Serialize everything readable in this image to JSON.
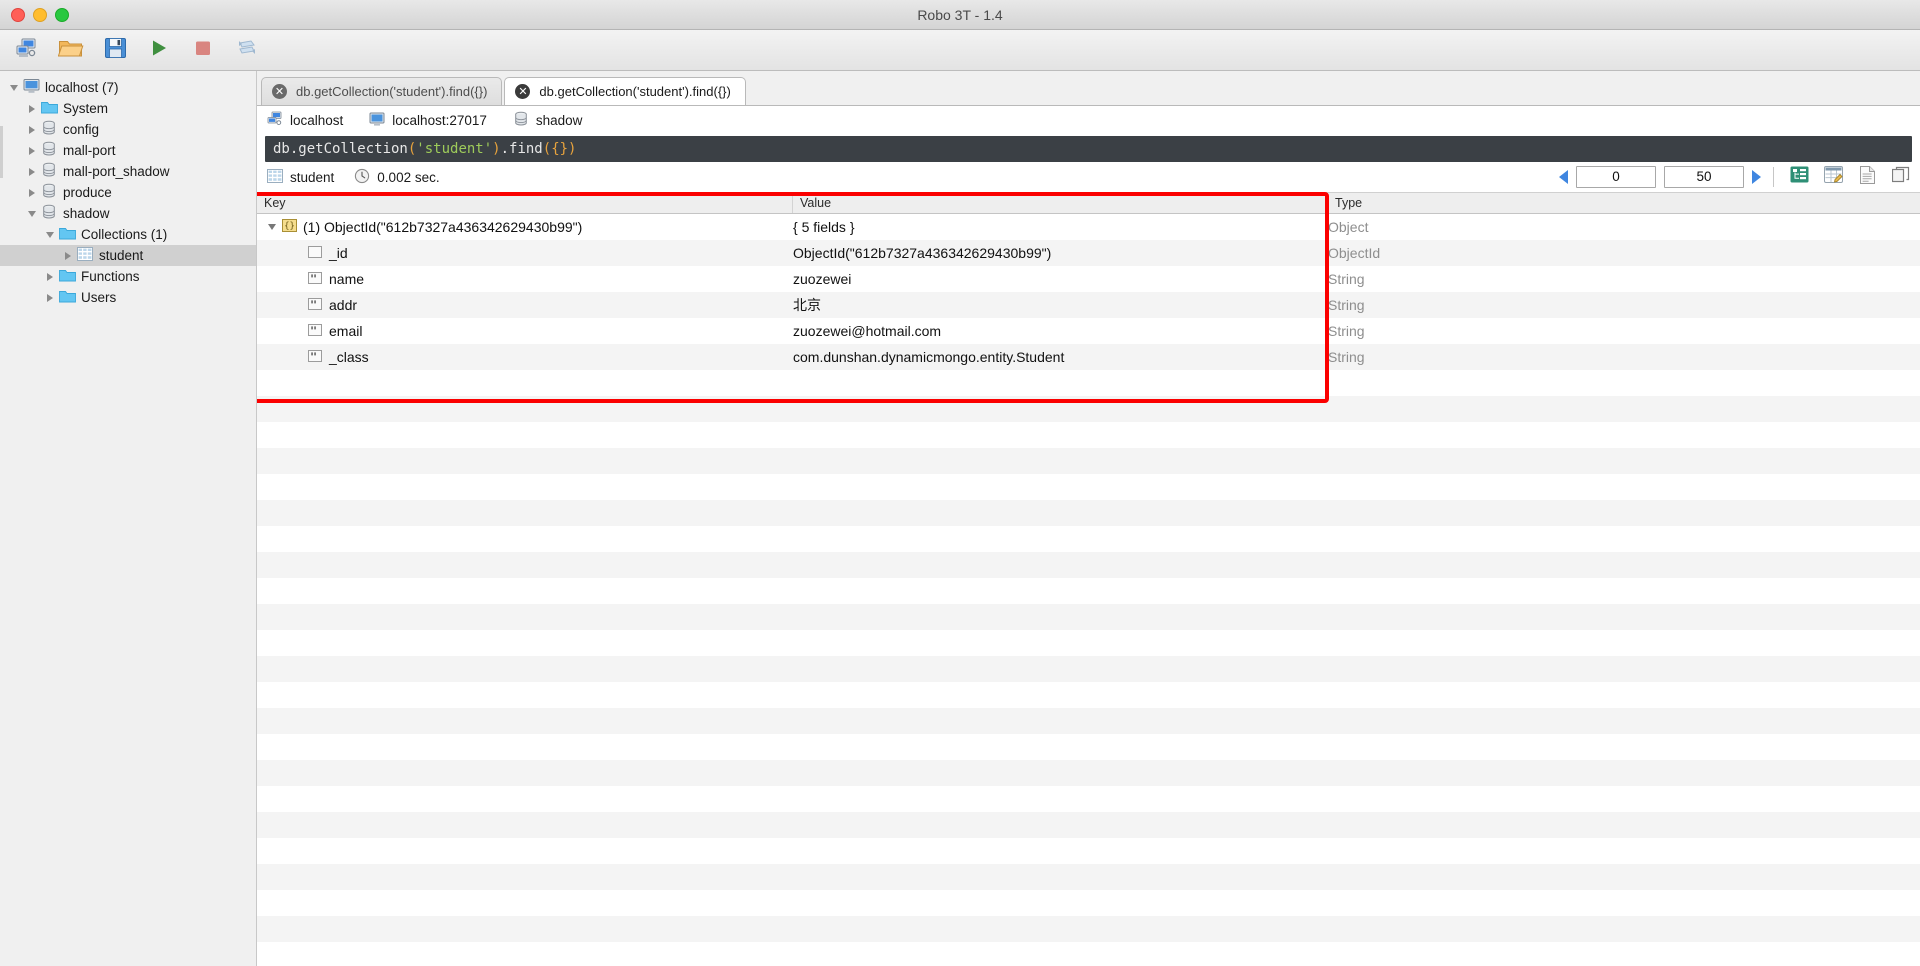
{
  "window": {
    "title": "Robo 3T - 1.4",
    "controls": [
      {
        "name": "close",
        "color": "#ff5f57"
      },
      {
        "name": "minimize",
        "color": "#ffbd2e"
      },
      {
        "name": "maximize",
        "color": "#28c840"
      }
    ]
  },
  "toolbar": {
    "buttons": [
      {
        "icon": "connect-icon",
        "label": "Connect"
      },
      {
        "icon": "open-folder-icon",
        "label": "Open Script"
      },
      {
        "icon": "save-icon",
        "label": "Save"
      },
      {
        "icon": "execute-play-icon",
        "label": "Execute"
      },
      {
        "icon": "stop-icon",
        "label": "Stop"
      },
      {
        "icon": "refresh-icon",
        "label": "Refresh"
      }
    ]
  },
  "sidebar": {
    "items": [
      {
        "label": "localhost (7)",
        "icon": "server-computer-icon",
        "depth": 0,
        "twisty": "open",
        "selected": false
      },
      {
        "label": "System",
        "icon": "folder-icon",
        "depth": 1,
        "twisty": "closed",
        "selected": false
      },
      {
        "label": "config",
        "icon": "database-icon",
        "depth": 1,
        "twisty": "closed",
        "selected": false
      },
      {
        "label": "mall-port",
        "icon": "database-icon",
        "depth": 1,
        "twisty": "closed",
        "selected": false
      },
      {
        "label": "mall-port_shadow",
        "icon": "database-icon",
        "depth": 1,
        "twisty": "closed",
        "selected": false
      },
      {
        "label": "produce",
        "icon": "database-icon",
        "depth": 1,
        "twisty": "closed",
        "selected": false
      },
      {
        "label": "shadow",
        "icon": "database-icon",
        "depth": 1,
        "twisty": "open",
        "selected": false
      },
      {
        "label": "Collections (1)",
        "icon": "folder-icon",
        "depth": 2,
        "twisty": "open",
        "selected": false
      },
      {
        "label": "student",
        "icon": "collection-grid-icon",
        "depth": 3,
        "twisty": "closed",
        "selected": true
      },
      {
        "label": "Functions",
        "icon": "folder-icon",
        "depth": 2,
        "twisty": "closed",
        "selected": false
      },
      {
        "label": "Users",
        "icon": "folder-icon",
        "depth": 2,
        "twisty": "closed",
        "selected": false
      }
    ]
  },
  "tabs": [
    {
      "label": "db.getCollection('student').find({})",
      "active": false,
      "close_icon": "close-icon"
    },
    {
      "label": "db.getCollection('student').find({})",
      "active": true,
      "close_icon": "close-icon"
    }
  ],
  "connection_bar": {
    "server": "localhost",
    "server_icon": "connection-icon",
    "host": "localhost:27017",
    "host_icon": "computer-icon",
    "database": "shadow",
    "database_icon": "database-icon"
  },
  "editor": {
    "full_text": "db.getCollection('student').find({})",
    "segments": [
      {
        "text": "db.getCollection",
        "kind": "plain"
      },
      {
        "text": "(",
        "kind": "paren"
      },
      {
        "text": "'student'",
        "kind": "string"
      },
      {
        "text": ")",
        "kind": "paren"
      },
      {
        "text": ".find",
        "kind": "plain"
      },
      {
        "text": "(",
        "kind": "paren"
      },
      {
        "text": "{}",
        "kind": "paren"
      },
      {
        "text": ")",
        "kind": "paren"
      }
    ]
  },
  "results_toolbar": {
    "collection_name": "student",
    "collection_icon": "collection-grid-icon",
    "clock_icon": "clock-icon",
    "elapsed": "0.002 sec.",
    "prev_icon": "arrow-left-icon",
    "next_icon": "arrow-right-icon",
    "skip_value": "0",
    "limit_value": "50",
    "view_buttons": [
      {
        "icon": "tree-view-icon",
        "label": "Tree Mode",
        "active": true
      },
      {
        "icon": "table-view-icon",
        "label": "Table Mode",
        "active": false
      },
      {
        "icon": "text-view-icon",
        "label": "Text Mode",
        "active": false
      },
      {
        "icon": "custom-view-icon",
        "label": "Custom Mode",
        "active": false
      }
    ]
  },
  "result_table": {
    "columns": [
      "Key",
      "Value",
      "Type"
    ],
    "rows": [
      {
        "key": "(1) ObjectId(\"612b7327a436342629430b99\")",
        "value": "{ 5 fields }",
        "type": "Object",
        "icon": "braces-object-icon",
        "expandable": true,
        "indent": 0
      },
      {
        "key": "_id",
        "value": "ObjectId(\"612b7327a436342629430b99\")",
        "type": "ObjectId",
        "icon": "objectid-icon",
        "expandable": false,
        "indent": 1
      },
      {
        "key": "name",
        "value": "zuozewei",
        "type": "String",
        "icon": "string-quotes-icon",
        "expandable": false,
        "indent": 1
      },
      {
        "key": "addr",
        "value": "北京",
        "type": "String",
        "icon": "string-quotes-icon",
        "expandable": false,
        "indent": 1
      },
      {
        "key": "email",
        "value": "zuozewei@hotmail.com",
        "type": "String",
        "icon": "string-quotes-icon",
        "expandable": false,
        "indent": 1
      },
      {
        "key": "_class",
        "value": "com.dunshan.dynamicmongo.entity.Student",
        "type": "String",
        "icon": "string-quotes-icon",
        "expandable": false,
        "indent": 1
      }
    ]
  },
  "annotation": {
    "name": "red-highlight-rectangle",
    "color": "#fb0000"
  }
}
